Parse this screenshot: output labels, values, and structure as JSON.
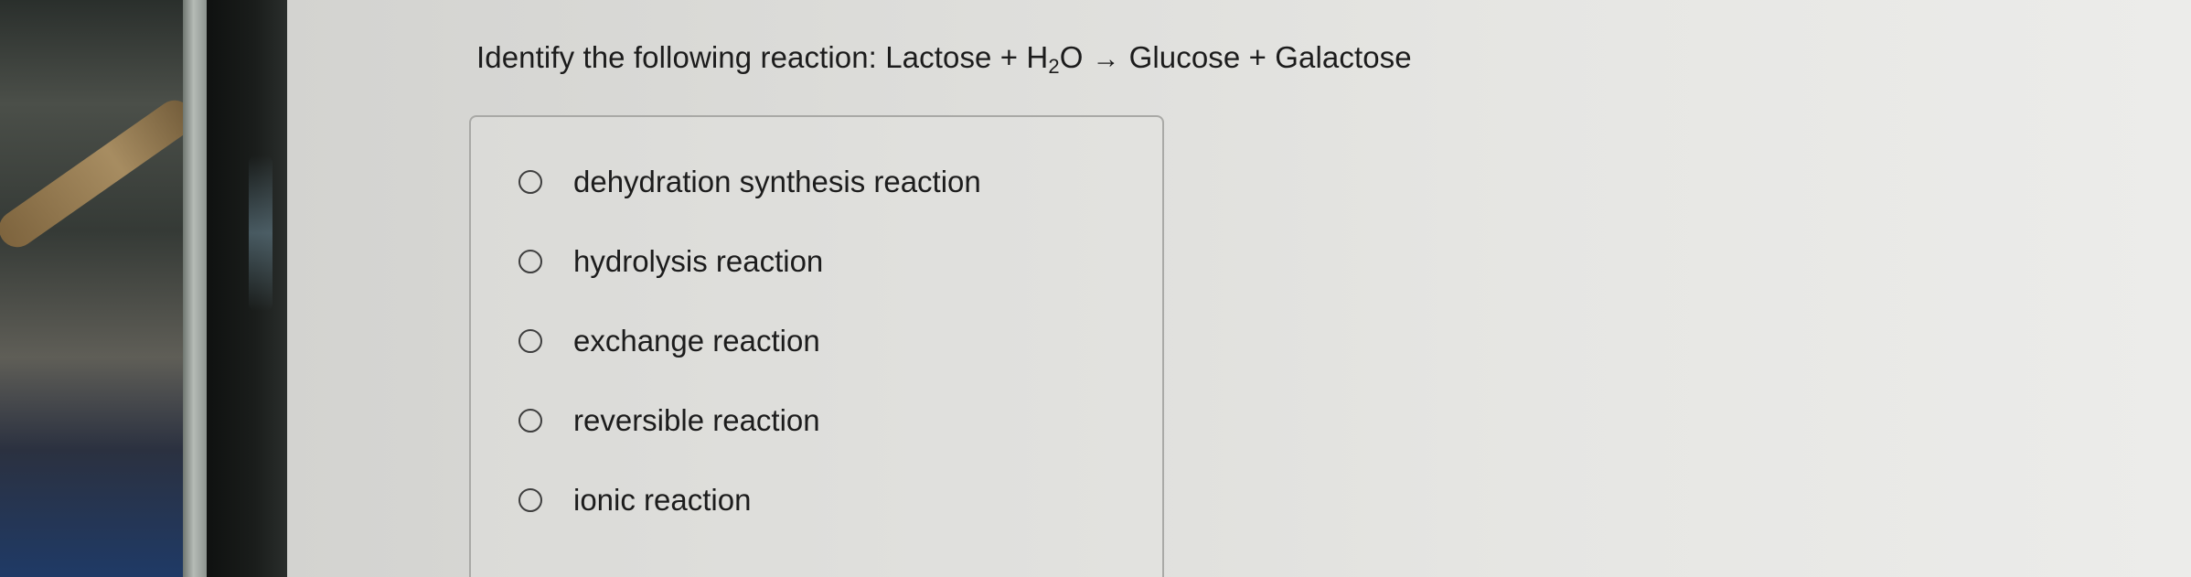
{
  "question": {
    "prefix": "Identify the following reaction: Lactose + H",
    "subscript": "2",
    "water_suffix": "O",
    "arrow": "→",
    "products": "Glucose + Galactose"
  },
  "options": [
    {
      "label": "dehydration synthesis reaction",
      "selected": false
    },
    {
      "label": "hydrolysis reaction",
      "selected": false
    },
    {
      "label": "exchange reaction",
      "selected": false
    },
    {
      "label": "reversible reaction",
      "selected": false
    },
    {
      "label": "ionic reaction",
      "selected": false
    }
  ]
}
